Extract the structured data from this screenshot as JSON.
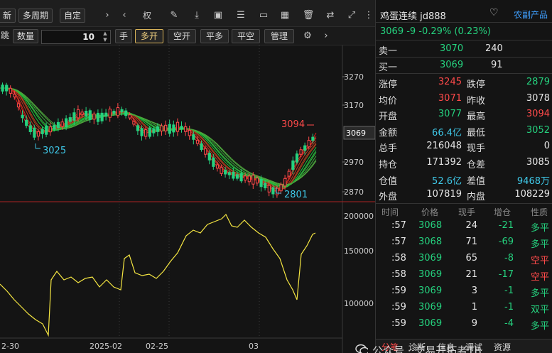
{
  "toolbar": {
    "new_label": "新",
    "multi_period": "多周期",
    "custom": "自定",
    "weight_label": "权",
    "jump_label": "跳",
    "qty_label": "数量",
    "qty_value": "10",
    "hand_label": "手",
    "buttons": [
      "多开",
      "空开",
      "平多",
      "平空",
      "管理"
    ]
  },
  "chart": {
    "price_ticks": [
      "3270",
      "3170",
      "3069",
      "2970",
      "2870"
    ],
    "current_price_box": "3069",
    "annot_high": "3094",
    "annot_low1": "3025",
    "annot_low2": "2801",
    "vol_ticks": [
      "200000",
      "150000",
      "100000"
    ],
    "date_labels": [
      "2-30",
      "2025-02",
      "02-25",
      "03"
    ]
  },
  "panel": {
    "name": "鸡蛋连续 jd888",
    "category": "农副产品",
    "quote": "3069  -9  -0.29%  (0.23%)",
    "ask_label": "卖一",
    "ask_price": "3070",
    "ask_vol": "240",
    "bid_label": "买一",
    "bid_price": "3069",
    "bid_vol": "91",
    "stats": [
      {
        "l1": "涨停",
        "v1": "3245",
        "c1": "red",
        "l2": "跌停",
        "v2": "2879",
        "c2": "green"
      },
      {
        "l1": "均价",
        "v1": "3071",
        "c1": "red",
        "l2": "昨收",
        "v2": "3078",
        "c2": "white"
      },
      {
        "l1": "开盘",
        "v1": "3077",
        "c1": "green",
        "l2": "最高",
        "v2": "3094",
        "c2": "red"
      },
      {
        "l1": "金额",
        "v1": "66.4亿",
        "c1": "cyan",
        "l2": "最低",
        "v2": "3052",
        "c2": "green"
      },
      {
        "l1": "总手",
        "v1": "216048",
        "c1": "white",
        "l2": "现手",
        "v2": "0",
        "c2": "white"
      },
      {
        "l1": "持仓",
        "v1": "171392",
        "c1": "white",
        "l2": "仓差",
        "v2": "3085",
        "c2": "white"
      },
      {
        "l1": "仓值",
        "v1": "52.6亿",
        "c1": "cyan",
        "l2": "差值",
        "v2": "9468万",
        "c2": "cyan"
      },
      {
        "l1": "外盘",
        "v1": "107819",
        "c1": "white",
        "l2": "内盘",
        "v2": "108229",
        "c2": "white"
      }
    ],
    "trade_headers": [
      "时间",
      "价格",
      "现手",
      "增仓",
      "性质"
    ],
    "trades": [
      {
        "time": ":57",
        "price": "3068",
        "vol": "24",
        "chg": "-21",
        "nature": "多平",
        "nc": "green"
      },
      {
        "time": ":57",
        "price": "3068",
        "vol": "71",
        "chg": "-69",
        "nature": "多平",
        "nc": "green"
      },
      {
        "time": ":58",
        "price": "3069",
        "vol": "65",
        "chg": "-8",
        "nature": "空平",
        "nc": "red"
      },
      {
        "time": ":58",
        "price": "3069",
        "vol": "21",
        "chg": "-17",
        "nature": "空平",
        "nc": "red"
      },
      {
        "time": ":59",
        "price": "3069",
        "vol": "3",
        "chg": "-1",
        "nature": "多平",
        "nc": "green"
      },
      {
        "time": ":59",
        "price": "3069",
        "vol": "1",
        "chg": "-1",
        "nature": "双平",
        "nc": "green"
      },
      {
        "time": ":59",
        "price": "3069",
        "vol": "9",
        "chg": "-4",
        "nature": "多平",
        "nc": "green"
      }
    ],
    "tabs": [
      "分笔",
      "诊断",
      "信息",
      "调试",
      "资源"
    ]
  },
  "watermark": "公众号 · 交易开拓者TB",
  "colors": {
    "up": "#ff4a4a",
    "down": "#25d17e",
    "accent": "#3fa0ff",
    "volume_line": "#f5e642"
  }
}
